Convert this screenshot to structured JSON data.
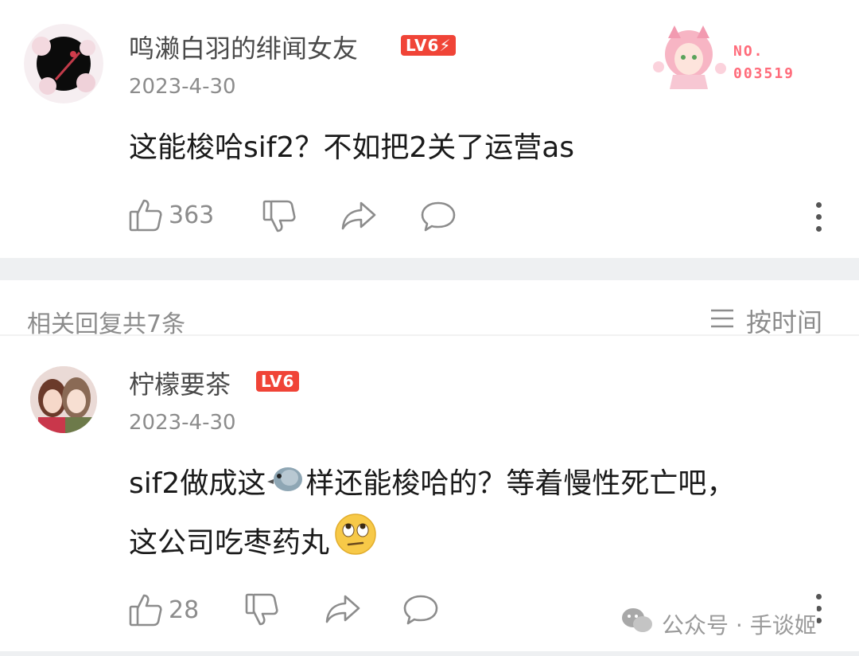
{
  "comment": {
    "username": "鸣濑白羽的绯闻女友",
    "level": "LV6",
    "date": "2023-4-30",
    "text": "这能梭哈sif2？不如把2关了运营as",
    "badge_no_label": "NO.",
    "badge_no_value": "003519",
    "likes": "363"
  },
  "replies_header": {
    "title": "相关回复共7条",
    "sort_label": "按时间"
  },
  "reply": {
    "username": "柠檬要茶",
    "level": "LV6",
    "date": "2023-4-30",
    "text_line1_a": "sif2做成这",
    "text_line1_b": "样还能梭哈的？等着慢性死亡吧，",
    "text_line2": "这公司吃枣药丸",
    "likes": "28"
  },
  "watermark": {
    "text": "公众号 · 手谈姬"
  },
  "icons": {
    "like": "thumbs-up-icon",
    "dislike": "thumbs-down-icon",
    "share": "share-icon",
    "comment": "comment-icon",
    "more": "more-vertical-icon",
    "sort": "menu-lines-icon",
    "wechat": "wechat-icon"
  },
  "colors": {
    "level_badge": "#f04437",
    "text_secondary": "#8c8c8c",
    "divider": "#eef0f2",
    "badge_pink": "#ff6b7a"
  }
}
